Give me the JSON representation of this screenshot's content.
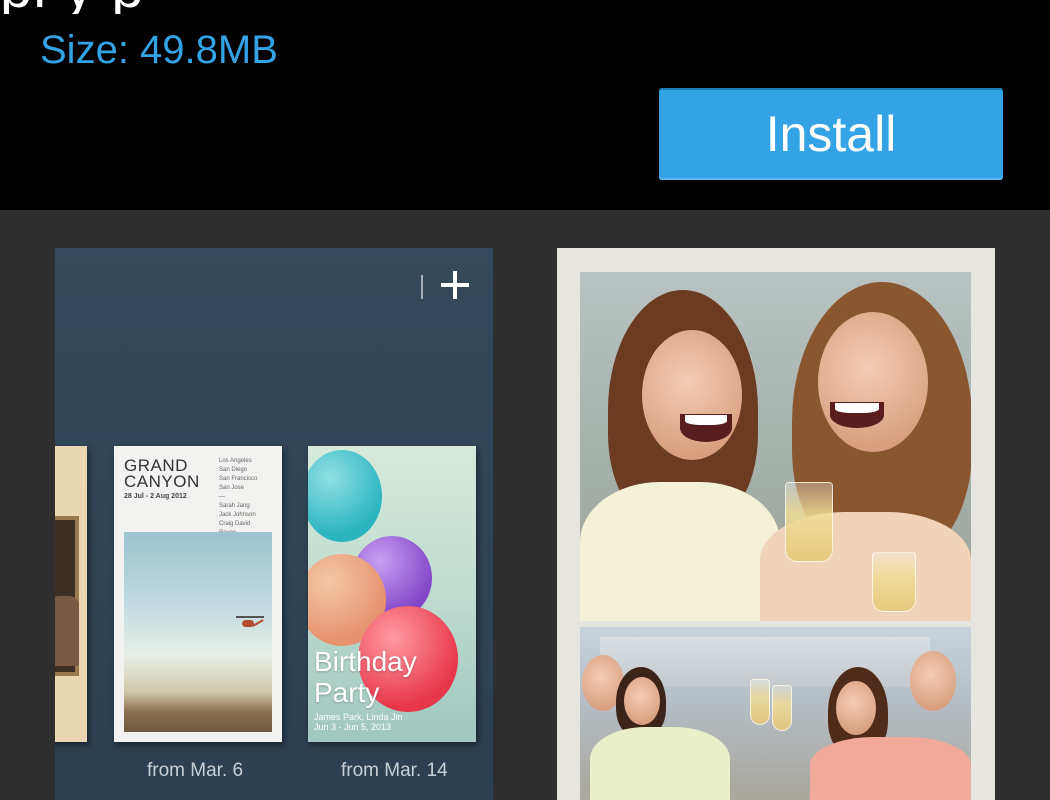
{
  "header": {
    "title_partial": "pl y p",
    "size_label": "Size: 49.8MB",
    "install_label": "Install"
  },
  "screenshots": [
    {
      "toolbar": {
        "add_icon": "plus-icon"
      },
      "books": [
        {
          "title_line1": "GRAND",
          "title_line2": "CANYON",
          "dates": "28 Jul - 2 Aug 2012",
          "details": [
            "Los Angeles",
            "San Diego",
            "San Francisco",
            "San Jose",
            "—",
            "Sarah Jang",
            "Jack Johnson",
            "Craig David",
            "Roven"
          ]
        },
        {
          "title_line1": "Birthday",
          "title_line2": "Party",
          "subtitle_line1": "James Park, Linda Jin",
          "subtitle_line2": "Jun 3 - Jun 5, 2013"
        }
      ],
      "captions": [
        "from Mar. 6",
        "from Mar. 14"
      ]
    },
    {
      "photos": [
        "two-women-laughing-photo",
        "group-toast-photo"
      ]
    }
  ],
  "colors": {
    "accent": "#33a3e6",
    "header_bg": "#000000",
    "gallery_bg": "#2e2e2e"
  }
}
